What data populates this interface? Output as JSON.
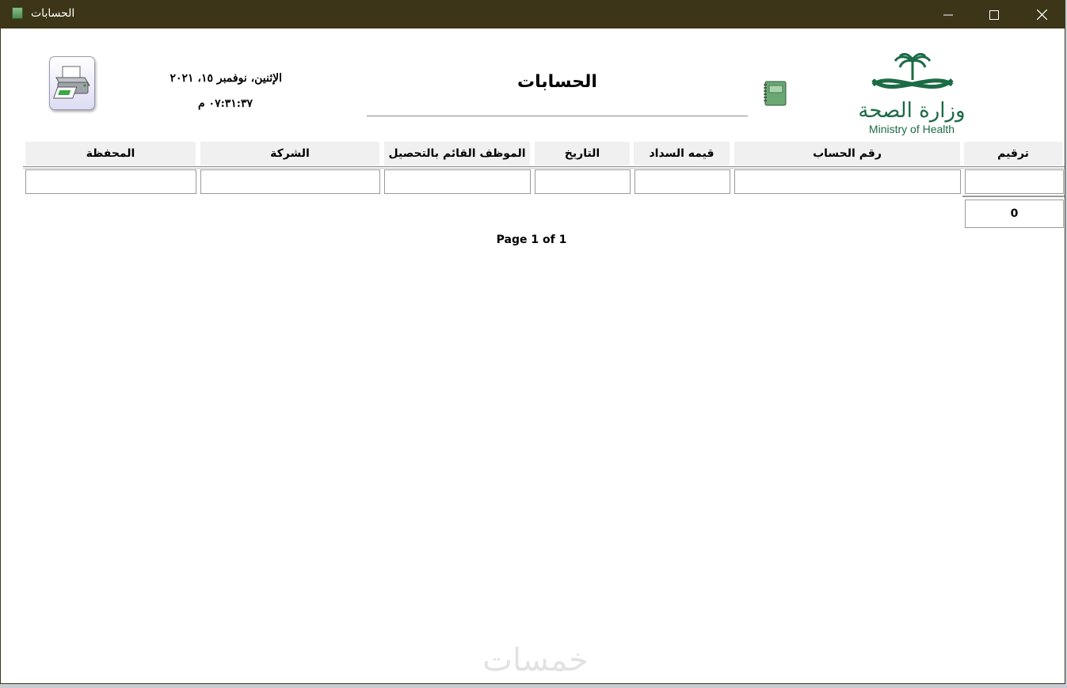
{
  "window": {
    "title": "الحسابات",
    "controls": {
      "minimize": "minimize",
      "maximize": "maximize",
      "close": "close"
    }
  },
  "header": {
    "date": "الإثنين، نوفمبر ١٥، ٢٠٢١",
    "time": "٠٧:٣١:٣٧ م",
    "report_title": "الحسابات"
  },
  "logo": {
    "arabic_text": "وزارة الصحة",
    "english_text": "Ministry of Health"
  },
  "table": {
    "columns": [
      {
        "key": "numbering",
        "label": "ترقيم"
      },
      {
        "key": "account_number",
        "label": "رقم الحساب"
      },
      {
        "key": "payment_value",
        "label": "قيمه السداد"
      },
      {
        "key": "date",
        "label": "التاريخ"
      },
      {
        "key": "collector",
        "label": "الموظف  القائم  بالتحصيل"
      },
      {
        "key": "company",
        "label": "الشركة"
      },
      {
        "key": "wallet",
        "label": "المحفظة"
      }
    ],
    "row_values": [
      "",
      "",
      "",
      "",
      "",
      "",
      ""
    ],
    "total_count": "0"
  },
  "footer": {
    "page_text": "Page 1 of 1"
  },
  "watermark": "خمسات",
  "colors": {
    "titlebar": "#3d3518",
    "logo_green": "#1b6b45",
    "header_bg": "#f0f0f0"
  },
  "icons": [
    "app-icon",
    "printer-icon",
    "notebook-icon",
    "minimize-icon",
    "maximize-icon",
    "close-icon"
  ]
}
